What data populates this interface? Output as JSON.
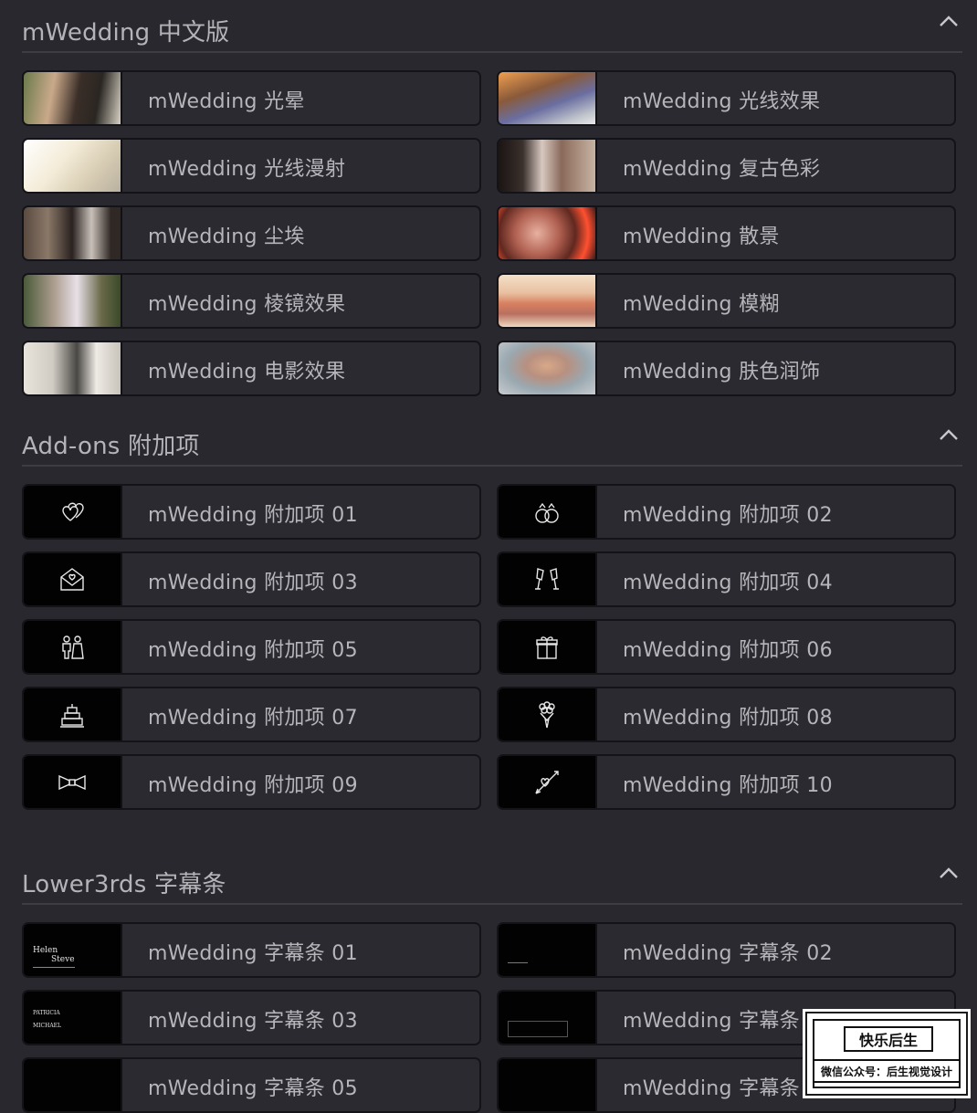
{
  "sections": [
    {
      "title": "mWedding 中文版",
      "items": [
        {
          "label": "mWedding 光晕"
        },
        {
          "label": "mWedding 光线效果"
        },
        {
          "label": "mWedding 光线漫射"
        },
        {
          "label": "mWedding 复古色彩"
        },
        {
          "label": "mWedding 尘埃"
        },
        {
          "label": "mWedding 散景"
        },
        {
          "label": "mWedding 棱镜效果"
        },
        {
          "label": "mWedding 模糊"
        },
        {
          "label": "mWedding 电影效果"
        },
        {
          "label": "mWedding 肤色润饰"
        }
      ]
    },
    {
      "title": "Add-ons 附加项",
      "items": [
        {
          "label": "mWedding 附加项 01",
          "icon": "hearts-icon"
        },
        {
          "label": "mWedding 附加项 02",
          "icon": "rings-icon"
        },
        {
          "label": "mWedding 附加项 03",
          "icon": "envelope-heart-icon"
        },
        {
          "label": "mWedding 附加项 04",
          "icon": "champagne-glasses-icon"
        },
        {
          "label": "mWedding 附加项 05",
          "icon": "couple-icon"
        },
        {
          "label": "mWedding 附加项 06",
          "icon": "gift-icon"
        },
        {
          "label": "mWedding 附加项 07",
          "icon": "wedding-cake-icon"
        },
        {
          "label": "mWedding 附加项 08",
          "icon": "bouquet-icon"
        },
        {
          "label": "mWedding 附加项 09",
          "icon": "bow-tie-icon"
        },
        {
          "label": "mWedding 附加项 10",
          "icon": "cupid-arrow-icon"
        }
      ]
    },
    {
      "title": "Lower3rds 字幕条",
      "items": [
        {
          "label": "mWedding 字幕条 01",
          "thumb_lines": [
            "Helen",
            "Steve"
          ]
        },
        {
          "label": "mWedding 字幕条 02"
        },
        {
          "label": "mWedding 字幕条 03",
          "thumb_lines": [
            "PATRICIA",
            "MICHAEL"
          ]
        },
        {
          "label": "mWedding 字幕条 04"
        },
        {
          "label": "mWedding 字幕条 05"
        },
        {
          "label": "mWedding 字幕条 06"
        }
      ]
    }
  ],
  "badge": {
    "title": "快乐后生",
    "subtitle": "微信公众号：后生视觉设计"
  },
  "colors": {
    "background": "#28282e",
    "card": "#2a2a30",
    "card_border": "#141418",
    "text": "#b5b5ba"
  }
}
